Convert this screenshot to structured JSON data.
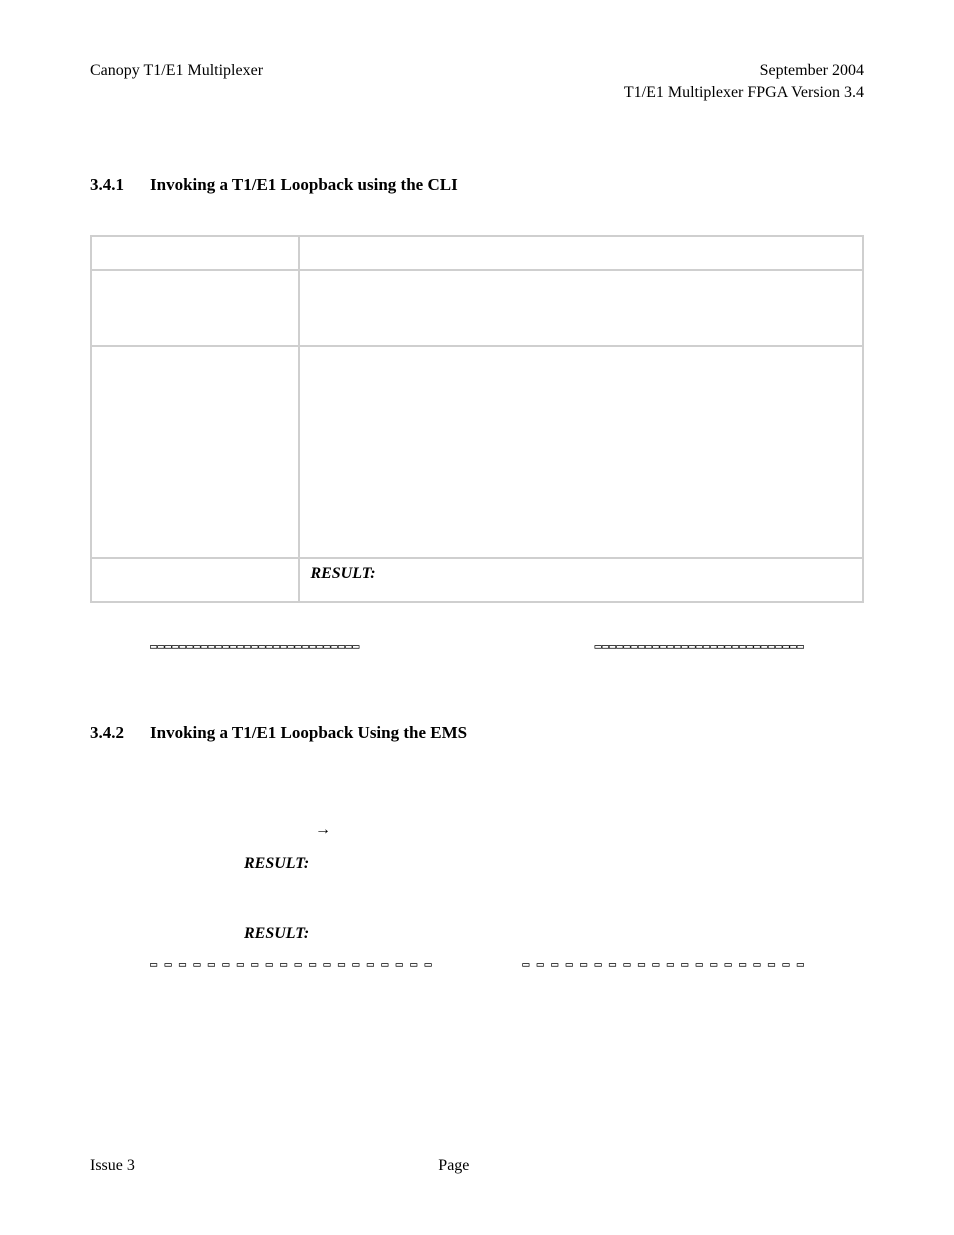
{
  "header": {
    "left": "Canopy T1/E1 Multiplexer",
    "right_line1": "September 2004",
    "right_line2": "T1/E1 Multiplexer FPGA Version 3.4"
  },
  "section1": {
    "number": "3.4.1",
    "title": "Invoking a T1/E1 Loopback using the CLI",
    "result_label": "RESULT:"
  },
  "section2": {
    "number": "3.4.2",
    "title": "Invoking a T1/E1 Loopback Using the EMS",
    "arrow": "→",
    "result_label_1": "RESULT:",
    "result_label_2": "RESULT:"
  },
  "footer": {
    "left": "Issue 3",
    "center": "Page"
  },
  "glyph_bar": "▭▭▭▭▭▭▭▭▭▭▭▭▭▭▭▭▭▭▭▭▭▭▭▭▭▭▭▭▭",
  "glyph_bar_dashed": "▭ ▭ ▭ ▭ ▭ ▭ ▭ ▭ ▭ ▭ ▭ ▭ ▭ ▭ ▭ ▭ ▭ ▭ ▭ ▭"
}
